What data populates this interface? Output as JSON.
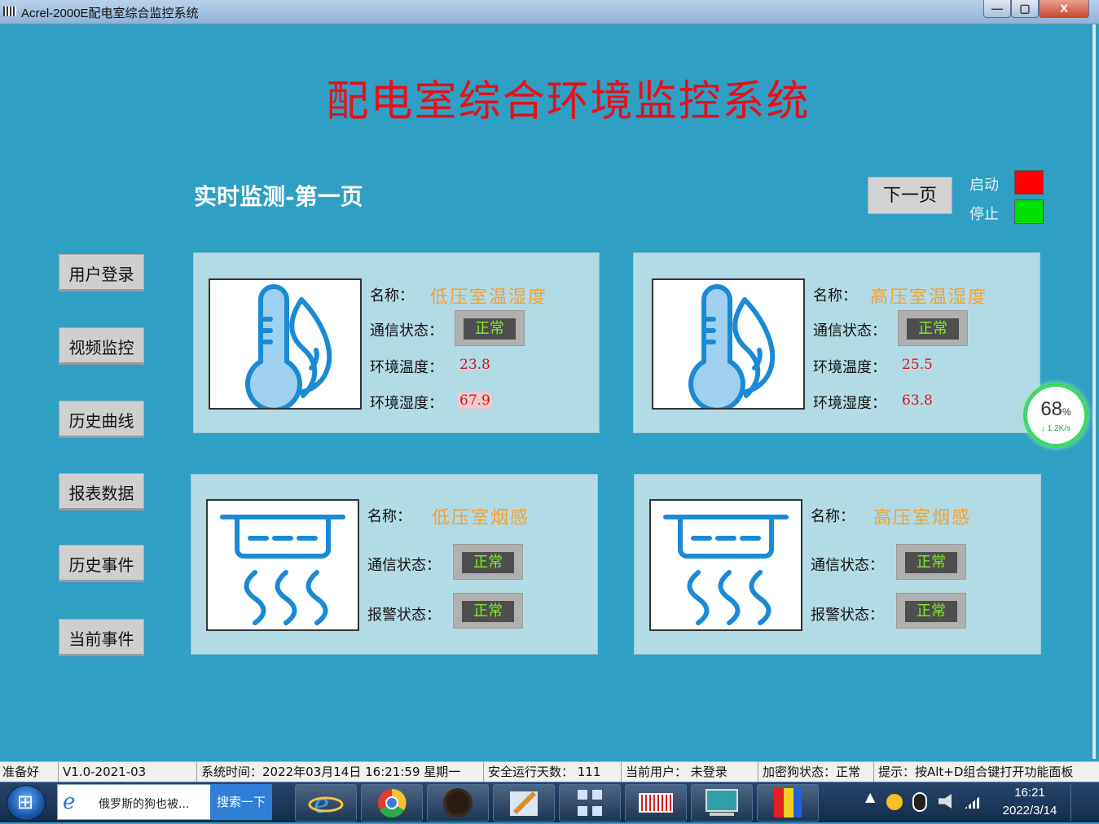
{
  "window": {
    "title": "Acrel-2000E配电室综合监控系统",
    "minimize": "—",
    "maximize": "▢",
    "close": "X"
  },
  "header": {
    "title": "配电室综合环境监控系统",
    "subtitle": "实时监测-第一页",
    "next_page": "下一页"
  },
  "legend": [
    {
      "label": "启动",
      "color": "#ff0000"
    },
    {
      "label": "停止",
      "color": "#00e000"
    }
  ],
  "nav": [
    "用户登录",
    "视频监控",
    "历史曲线",
    "报表数据",
    "历史事件",
    "当前事件"
  ],
  "panels": {
    "lv_temp": {
      "icon": "thermometer-humidity-icon",
      "name_label": "名称：",
      "name": "低压室温湿度",
      "comm_label": "通信状态：",
      "comm_status": "正常",
      "temp_label": "环境温度：",
      "temp": "23.8",
      "humidity_label": "环境湿度：",
      "humidity": "67.9"
    },
    "hv_temp": {
      "icon": "thermometer-humidity-icon",
      "name_label": "名称：",
      "name": "高压室温湿度",
      "comm_label": "通信状态：",
      "comm_status": "正常",
      "temp_label": "环境温度：",
      "temp": "25.5",
      "humidity_label": "环境湿度：",
      "humidity": "63.8"
    },
    "lv_smoke": {
      "icon": "smoke-detector-icon",
      "name_label": "名称：",
      "name": "低压室烟感",
      "comm_label": "通信状态：",
      "comm_status": "正常",
      "alarm_label": "报警状态：",
      "alarm_status": "正常"
    },
    "hv_smoke": {
      "icon": "smoke-detector-icon",
      "name_label": "名称：",
      "name": "高压室烟感",
      "comm_label": "通信状态：",
      "comm_status": "正常",
      "alarm_label": "报警状态：",
      "alarm_status": "正常"
    }
  },
  "network_gauge": {
    "percent": "68",
    "unit": "%",
    "speed": "↓ 1.2K/s"
  },
  "statusbar": {
    "ready": "准备好",
    "version": "V1.0-2021-03",
    "system_time": "系统时间：2022年03月14日   16:21:59    星期一",
    "safe_days": "安全运行天数：  111",
    "current_user": "当前用户：  未登录",
    "dongle": "加密狗状态：正常",
    "hint": "提示：按Alt+D组合键打开功能面板"
  },
  "taskbar": {
    "search_text": "俄罗斯的狗也被...",
    "search_button": "搜索一下",
    "clock_time": "16:21",
    "clock_date": "2022/3/14",
    "tray_arrow": "▲"
  },
  "colors": {
    "background": "#2f9fc4",
    "panel": "#b3dbe6",
    "title_red": "#e8101a",
    "name_orange": "#f0a030",
    "status_green": "#7df021"
  }
}
